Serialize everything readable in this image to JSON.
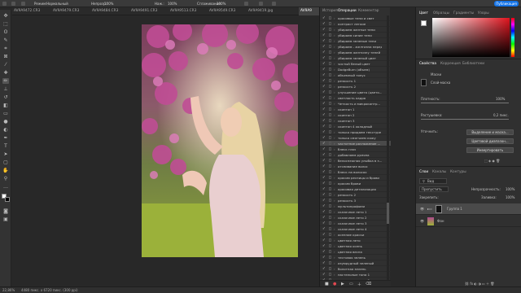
{
  "options_bar": {
    "mode_label": "Режим:",
    "mode_value": "Нормальный",
    "opacity_label": "Непрозр.:",
    "opacity_value": "100%",
    "flow_label": "Наж.:",
    "flow_value": "100%",
    "smoothing_label": "Сглаживание:",
    "smoothing_value": "100%",
    "share_label": "Публикация"
  },
  "doc_tabs": [
    "AV9A9472.CR3",
    "AV9A9479.CR3",
    "AV9A9484.CR3",
    "AV9A9491.CR3",
    "AV9A9513.CR3",
    "AV9A9549.CR3",
    "AV9A9419.jpg",
    "AV9A9"
  ],
  "mid_panel": {
    "tabs": [
      "История",
      "Операции",
      "Комментар"
    ],
    "actions": [
      "красивые тени и свет",
      "контраст легкие",
      "убираем желтые тени",
      "убираем синие тени",
      "убираем зеленые тени",
      "убираем - желтизна перед...",
      "убираем желтизну теней",
      "убираем зеленый цвет",
      "чистый белый цвет",
      "DodgeBurn (объем)",
      "объемный тонус",
      "резкость 1",
      "резкость 2",
      "улучшение цвета (цвето...",
      "светлость кадра",
      "Четкость и микроконтр...",
      "скинтон 1",
      "скинтон 2",
      "скинтон 3",
      "скинтон 4 холодный",
      "только придаем текстуре",
      "только смягчаем кожу",
      "частотное разложение ...",
      "блеск глаз",
      "добавляем румяна",
      "белоснежная улыбка в з...",
      "отсеивание волос",
      "блеск на волосах",
      "красим ресницы и брови",
      "красим брови",
      "красивая детализация",
      "резкость 2",
      "резкость 3",
      "мультипрофили",
      "сказочное лето 1",
      "сказочное лето 2",
      "сказочное лето 3",
      "сказочное лето 4",
      "осенние краски",
      "цветная лето",
      "цветная осень",
      "цветная весна",
      "тестовая зелень",
      "изумрудный зеленый",
      "болотная зелень",
      "пастельные тона 1",
      "пастельные тона 2"
    ],
    "selected_index": 22
  },
  "right_panel": {
    "color_tabs": [
      "Цвет",
      "Образцы",
      "Градиенты",
      "Узоры"
    ],
    "prop_tabs": [
      "Свойства",
      "Коррекция",
      "Библиотеки"
    ],
    "masks_label": "Маски",
    "layer_mask_label": "Слой-маска",
    "density_label": "Плотность:",
    "density_value": "100%",
    "feather_label": "Растушевка:",
    "feather_value": "0,2 пикс.",
    "refine_label": "Уточнить:",
    "select_mask_btn": "Выделение и маска...",
    "color_range_btn": "Цветовой диапазон...",
    "invert_btn": "Инвертировать",
    "layer_tabs": [
      "Слои",
      "Каналы",
      "Контуры"
    ],
    "kind_label": "Вид",
    "blend_mode": "Пропустить",
    "opacity_label": "Непрозрачность:",
    "opacity_value": "100%",
    "lock_label": "Закрепить:",
    "fill_label": "Заливка:",
    "fill_value": "100%",
    "layers": [
      "Группа 1",
      "Фон"
    ]
  },
  "status": {
    "zoom": "22,86%",
    "doc_info": "4480 пикс. x 6720 пикс. (300 ppi)"
  }
}
